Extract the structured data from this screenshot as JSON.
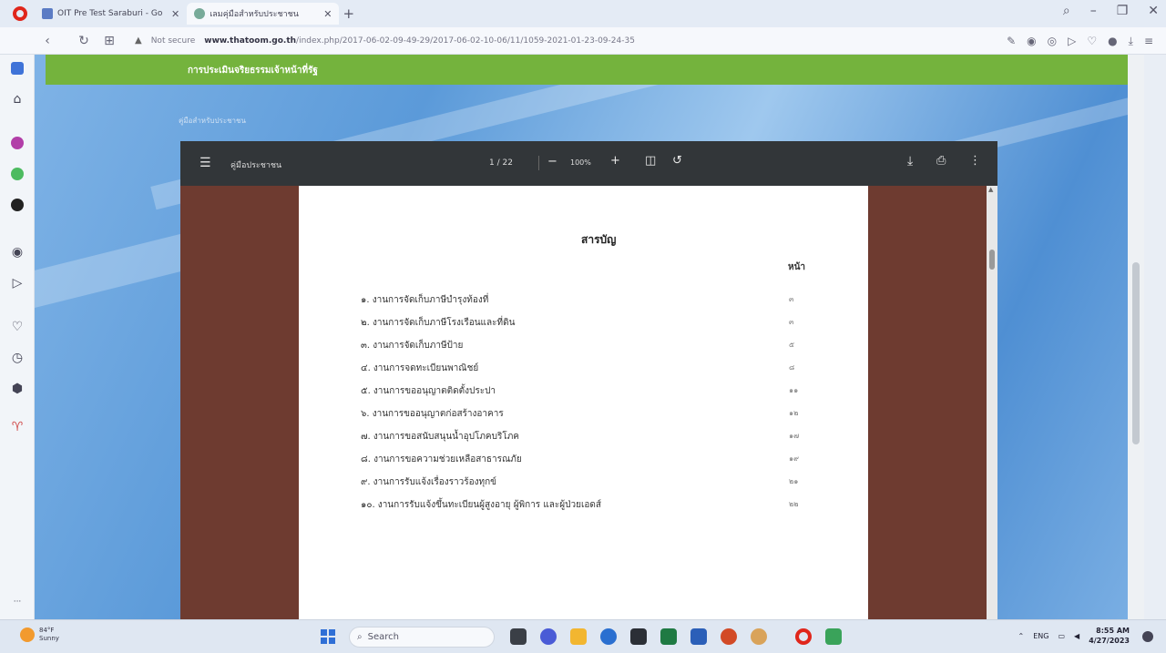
{
  "browser": {
    "tabs": [
      {
        "title": "OIT Pre Test Saraburi - Go",
        "active": false
      },
      {
        "title": "เลมคุ่มือสำหรับประชาชน",
        "active": true
      }
    ],
    "address": {
      "security": "Not secure",
      "host": "www.thatoom.go.th",
      "path": "/index.php/2017-06-02-09-49-29/2017-06-02-10-06/11/1059-2021-01-23-09-24-35"
    }
  },
  "page": {
    "banner_title": "การประเมินจริยธรรมเจ้าหน้าที่รัฐ",
    "breadcrumb": "คู่มือสำหรับประชาชน"
  },
  "pdf_viewer": {
    "doc_title": "คู่มือประชาชน",
    "page_indicator": "1 / 22",
    "zoom": "100%",
    "toc_heading": "สารบัญ",
    "page_column_header": "หน้า",
    "toc": [
      {
        "text": "๑. งานการจัดเก็บภาษีบำรุงท้องที่",
        "page": "๓"
      },
      {
        "text": "๒. งานการจัดเก็บภาษีโรงเรือนและที่ดิน",
        "page": "๓"
      },
      {
        "text": "๓. งานการจัดเก็บภาษีป้าย",
        "page": "๕"
      },
      {
        "text": "๔. งานการจดทะเบียนพาณิชย์",
        "page": "๘"
      },
      {
        "text": "๕. งานการขออนุญาตติดตั้งประปา",
        "page": "๑๑"
      },
      {
        "text": "๖. งานการขออนุญาตก่อสร้างอาคาร",
        "page": "๑๒"
      },
      {
        "text": "๗. งานการขอสนับสนุนน้ำอุปโภคบริโภค",
        "page": "๑๗"
      },
      {
        "text": "๘. งานการขอความช่วยเหลือสาธารณภัย",
        "page": "๑๙"
      },
      {
        "text": "๙. งานการรับแจ้งเรื่องราวร้องทุกข์",
        "page": "๒๑"
      },
      {
        "text": "๑๐. งานการรับแจ้งขึ้นทะเบียนผู้สูงอายุ ผู้พิการ และผู้ป่วยเอดส์",
        "page": "๒๒"
      }
    ]
  },
  "taskbar": {
    "weather": {
      "temp": "84°F",
      "condition": "Sunny"
    },
    "search_label": "Search",
    "language": "ENG",
    "time": "8:55 AM",
    "date": "4/27/2023"
  }
}
